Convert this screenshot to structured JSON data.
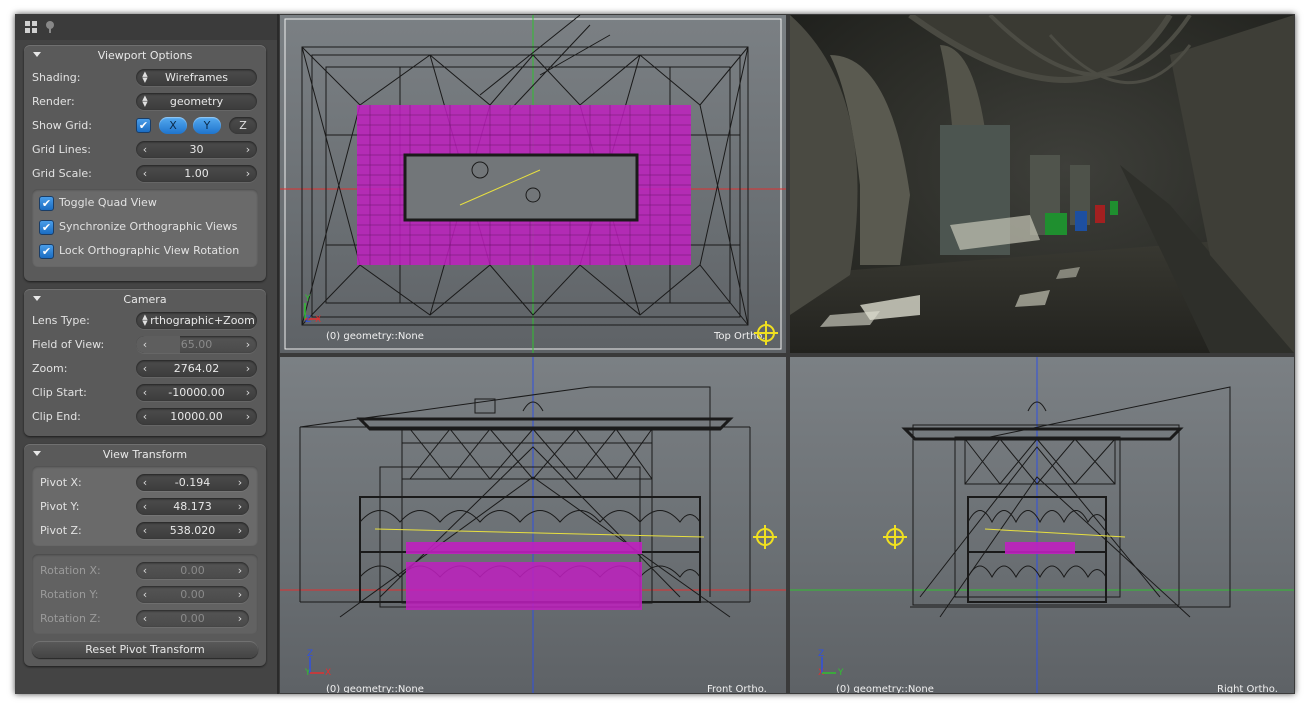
{
  "sidebar": {
    "viewport_options": {
      "title": "Viewport Options",
      "shading_label": "Shading:",
      "shading_value": "Wireframes",
      "render_label": "Render:",
      "render_value": "geometry",
      "show_grid_label": "Show Grid:",
      "grid_x": "X",
      "grid_y": "Y",
      "grid_z": "Z",
      "grid_lines_label": "Grid Lines:",
      "grid_lines_value": "30",
      "grid_scale_label": "Grid Scale:",
      "grid_scale_value": "1.00",
      "toggle_quad": "Toggle Quad View",
      "sync_ortho": "Synchronize Orthographic Views",
      "lock_ortho": "Lock Orthographic View Rotation"
    },
    "camera": {
      "title": "Camera",
      "lens_label": "Lens Type:",
      "lens_value": "rthographic+Zoom",
      "fov_label": "Field of View:",
      "fov_value": "65.00",
      "zoom_label": "Zoom:",
      "zoom_value": "2764.02",
      "clip_start_label": "Clip Start:",
      "clip_start_value": "-10000.00",
      "clip_end_label": "Clip End:",
      "clip_end_value": "10000.00"
    },
    "view_transform": {
      "title": "View Transform",
      "pivot_x_label": "Pivot X:",
      "pivot_x_value": "-0.194",
      "pivot_y_label": "Pivot Y:",
      "pivot_y_value": "48.173",
      "pivot_z_label": "Pivot Z:",
      "pivot_z_value": "538.020",
      "rot_x_label": "Rotation X:",
      "rot_x_value": "0.00",
      "rot_y_label": "Rotation Y:",
      "rot_y_value": "0.00",
      "rot_z_label": "Rotation Z:",
      "rot_z_value": "0.00",
      "reset_label": "Reset Pivot Transform"
    }
  },
  "viewports": {
    "top": {
      "info": "(0) geometry::None",
      "name": "Top Ortho."
    },
    "front": {
      "info": "(0) geometry::None",
      "name": "Front Ortho."
    },
    "right": {
      "info": "(0) geometry::None",
      "name": "Right Ortho."
    }
  },
  "axes": {
    "top": [
      "Y",
      "Z",
      "X"
    ],
    "front": [
      "Z",
      "Y",
      "X"
    ],
    "right": [
      "Z",
      "X",
      "Y"
    ]
  },
  "colors": {
    "accent": "#2a7fd6",
    "wire": "#1a1a1a",
    "selection": "#c020c0",
    "x_axis": "#e03030",
    "y_axis": "#30c030",
    "z_axis": "#3050e0",
    "pivot": "#f0e020"
  }
}
